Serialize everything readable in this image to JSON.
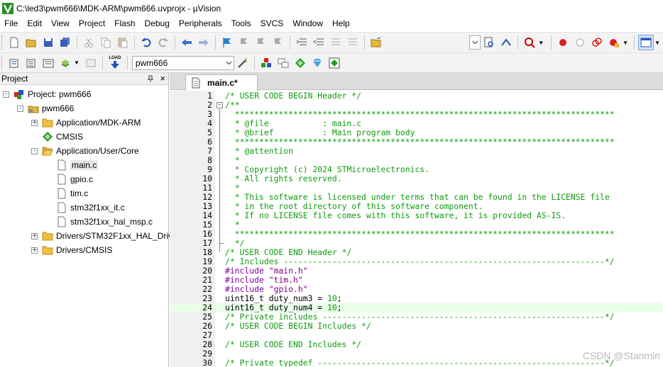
{
  "window": {
    "title": "C:\\led3\\pwm666\\MDK-ARM\\pwm666.uvprojx - µVision"
  },
  "menu": [
    "File",
    "Edit",
    "View",
    "Project",
    "Flash",
    "Debug",
    "Peripherals",
    "Tools",
    "SVCS",
    "Window",
    "Help"
  ],
  "toolbar": {
    "target": "pwm666",
    "load_label": "LOAD"
  },
  "project_panel": {
    "title": "Project",
    "pin_icon": "pin-icon",
    "close_label": "×",
    "tree": [
      {
        "label": "Project: pwm666",
        "icon": "project-icon",
        "level": 0,
        "expander": "-"
      },
      {
        "label": "pwm666",
        "icon": "target-icon",
        "level": 1,
        "expander": "-"
      },
      {
        "label": "Application/MDK-ARM",
        "icon": "folder-icon",
        "level": 2,
        "expander": "+"
      },
      {
        "label": "CMSIS",
        "icon": "diamond-icon",
        "level": 2,
        "expander": ""
      },
      {
        "label": "Application/User/Core",
        "icon": "folder-open-icon",
        "level": 2,
        "expander": "-"
      },
      {
        "label": "main.c",
        "icon": "file-icon",
        "level": 3,
        "expander": "",
        "selected": true
      },
      {
        "label": "gpio.c",
        "icon": "file-icon",
        "level": 3,
        "expander": ""
      },
      {
        "label": "tim.c",
        "icon": "file-icon",
        "level": 3,
        "expander": ""
      },
      {
        "label": "stm32f1xx_it.c",
        "icon": "file-icon",
        "level": 3,
        "expander": ""
      },
      {
        "label": "stm32f1xx_hal_msp.c",
        "icon": "file-icon",
        "level": 3,
        "expander": ""
      },
      {
        "label": "Drivers/STM32F1xx_HAL_Driv",
        "icon": "folder-icon",
        "level": 2,
        "expander": "+"
      },
      {
        "label": "Drivers/CMSIS",
        "icon": "folder-icon",
        "level": 2,
        "expander": "+"
      }
    ]
  },
  "editor": {
    "active_tab": "main.c*",
    "current_line": 24,
    "lines": [
      {
        "n": "1",
        "segs": [
          [
            "cmt",
            "/* USER CODE BEGIN Header */"
          ]
        ]
      },
      {
        "n": "2",
        "segs": [
          [
            "cmt",
            "/**"
          ]
        ]
      },
      {
        "n": "3",
        "segs": [
          [
            "cmt",
            "  ******************************************************************************"
          ]
        ]
      },
      {
        "n": "4",
        "segs": [
          [
            "cmt",
            "  * @file           : main.c"
          ]
        ]
      },
      {
        "n": "5",
        "segs": [
          [
            "cmt",
            "  * @brief          : Main program body"
          ]
        ]
      },
      {
        "n": "6",
        "segs": [
          [
            "cmt",
            "  ******************************************************************************"
          ]
        ]
      },
      {
        "n": "7",
        "segs": [
          [
            "cmt",
            "  * @attention"
          ]
        ]
      },
      {
        "n": "8",
        "segs": [
          [
            "cmt",
            "  *"
          ]
        ]
      },
      {
        "n": "9",
        "segs": [
          [
            "cmt",
            "  * Copyright (c) 2024 STMicroelectronics."
          ]
        ]
      },
      {
        "n": "10",
        "segs": [
          [
            "cmt",
            "  * All rights reserved."
          ]
        ]
      },
      {
        "n": "11",
        "segs": [
          [
            "cmt",
            "  *"
          ]
        ]
      },
      {
        "n": "12",
        "segs": [
          [
            "cmt",
            "  * This software is licensed under terms that can be found in the LICENSE file"
          ]
        ]
      },
      {
        "n": "13",
        "segs": [
          [
            "cmt",
            "  * in the root directory of this software component."
          ]
        ]
      },
      {
        "n": "14",
        "segs": [
          [
            "cmt",
            "  * If no LICENSE file comes with this software, it is provided AS-IS."
          ]
        ]
      },
      {
        "n": "15",
        "segs": [
          [
            "cmt",
            "  *"
          ]
        ]
      },
      {
        "n": "16",
        "segs": [
          [
            "cmt",
            "  ******************************************************************************"
          ]
        ]
      },
      {
        "n": "17",
        "segs": [
          [
            "cmt",
            "  */"
          ]
        ]
      },
      {
        "n": "18",
        "segs": [
          [
            "cmt",
            "/* USER CODE END Header */"
          ]
        ]
      },
      {
        "n": "19",
        "segs": [
          [
            "cmt",
            "/* Includes ------------------------------------------------------------------*/"
          ]
        ]
      },
      {
        "n": "20",
        "segs": [
          [
            "pp",
            "#include "
          ],
          [
            "str",
            "\"main.h\""
          ]
        ]
      },
      {
        "n": "21",
        "segs": [
          [
            "pp",
            "#include "
          ],
          [
            "str",
            "\"tim.h\""
          ]
        ]
      },
      {
        "n": "22",
        "segs": [
          [
            "pp",
            "#include "
          ],
          [
            "str",
            "\"gpio.h\""
          ]
        ]
      },
      {
        "n": "23",
        "segs": [
          [
            "plain",
            "uint16_t duty_num3 = "
          ],
          [
            "num",
            "10"
          ],
          [
            "plain",
            ";"
          ]
        ]
      },
      {
        "n": "24",
        "segs": [
          [
            "plain",
            "uint16_t duty_num4 = "
          ],
          [
            "num",
            "10"
          ],
          [
            "plain",
            ";"
          ]
        ]
      },
      {
        "n": "25",
        "segs": [
          [
            "cmt",
            "/* Private includes ----------------------------------------------------------*/"
          ]
        ]
      },
      {
        "n": "26",
        "segs": [
          [
            "cmt",
            "/* USER CODE BEGIN Includes */"
          ]
        ]
      },
      {
        "n": "27",
        "segs": []
      },
      {
        "n": "28",
        "segs": [
          [
            "cmt",
            "/* USER CODE END Includes */"
          ]
        ]
      },
      {
        "n": "29",
        "segs": []
      },
      {
        "n": "30",
        "segs": [
          [
            "cmt",
            "/* Private typedef -----------------------------------------------------------*/"
          ]
        ]
      }
    ]
  },
  "watermark": "CSDN @Stanmin",
  "colors": {
    "comment": "#0f9d0f",
    "preprocessor": "#8000a0",
    "string": "#800080",
    "number": "#00a000",
    "current_line": "#e8ffe8"
  }
}
